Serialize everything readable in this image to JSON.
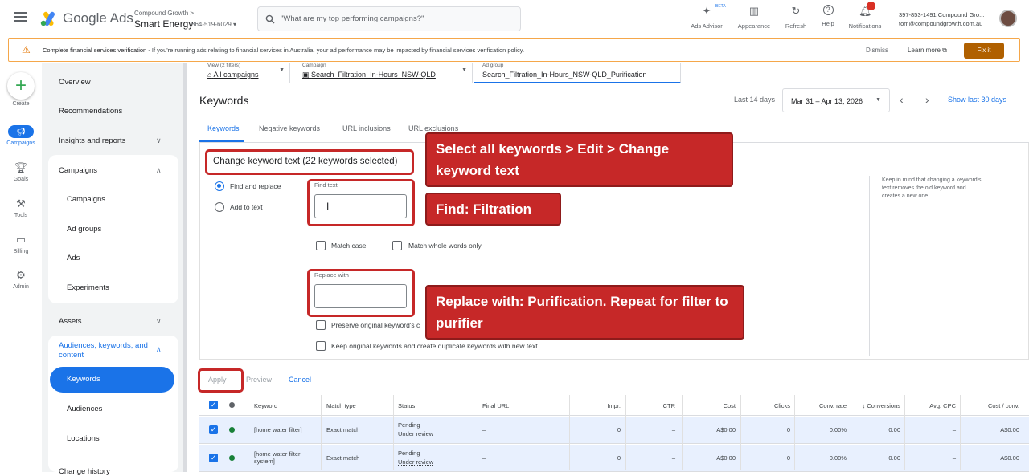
{
  "topbar": {
    "product": "Google Ads",
    "account_small": "Compound Growth",
    "account_name": "Smart Energy",
    "account_id": "864-519-6029",
    "search_placeholder": "\"What are my top performing campaigns?\"",
    "items": [
      {
        "label": "Ads Advisor",
        "icon": "sparkle-icon",
        "badge": "BETA"
      },
      {
        "label": "Appearance",
        "icon": "appearance-icon"
      },
      {
        "label": "Refresh",
        "icon": "refresh-icon"
      },
      {
        "label": "Help",
        "icon": "help-icon"
      },
      {
        "label": "Notifications",
        "icon": "bell-icon",
        "badge": "!"
      }
    ],
    "user_line1": "397-853-1491 Compound Gro...",
    "user_line2": "tom@compoundgrowth.com.au"
  },
  "banner": {
    "title": "Complete financial services verification",
    "message": " - If you're running ads relating to financial services in Australia, your ad performance may be impacted by financial services verification policy.",
    "dismiss": "Dismiss",
    "learn_more": "Learn more",
    "fix": "Fix it"
  },
  "rail": {
    "create": "Create",
    "campaigns": "Campaigns",
    "goals": "Goals",
    "tools": "Tools",
    "billing": "Billing",
    "admin": "Admin"
  },
  "nav": {
    "overview": "Overview",
    "recommendations": "Recommendations",
    "insights": "Insights and reports",
    "campaigns_group": "Campaigns",
    "campaigns": "Campaigns",
    "ad_groups": "Ad groups",
    "ads": "Ads",
    "experiments": "Experiments",
    "assets": "Assets",
    "audiences_group": "Audiences, keywords, and content",
    "keywords": "Keywords",
    "audiences": "Audiences",
    "locations": "Locations",
    "change_history": "Change history"
  },
  "filters": {
    "view_label": "View (2 filters)",
    "view_value": "All campaigns",
    "campaign_label": "Campaign",
    "campaign_value": "Search_Filtration_In-Hours_NSW-QLD",
    "adgroup_label": "Ad group",
    "adgroup_value": "Search_Filtration_In-Hours_NSW-QLD_Purification"
  },
  "page": {
    "title": "Keywords",
    "date_last": "Last 14 days",
    "date_range": "Mar 31 – Apr 13, 2026",
    "show_last": "Show last 30 days",
    "tabs": [
      "Keywords",
      "Negative keywords",
      "URL inclusions",
      "URL exclusions"
    ]
  },
  "panel": {
    "title": "Change keyword text (22 keywords selected)",
    "find_replace": "Find and replace",
    "add_to_text": "Add to text",
    "find_label": "Find text",
    "match_case": "Match case",
    "match_whole": "Match whole words only",
    "replace_label": "Replace with",
    "preserve": "Preserve original keyword's c",
    "keep_original": "Keep original keywords and create duplicate keywords with new text",
    "note": "Keep in mind that changing a keyword's text removes the old keyword and creates a new one.",
    "apply": "Apply",
    "preview": "Preview",
    "cancel": "Cancel"
  },
  "callouts": {
    "c1": "Select all keywords > Edit > Change keyword text",
    "c2": "Find: Filtration",
    "c3": "Replace with: Purification. Repeat for filter to purifier"
  },
  "table": {
    "headers": [
      "Keyword",
      "Match type",
      "Status",
      "Final URL",
      "Impr.",
      "CTR",
      "Cost",
      "Clicks",
      "Conv. rate",
      "Conversions",
      "Avg. CPC",
      "Cost / conv."
    ],
    "rows": [
      {
        "keyword": "[home water filter]",
        "match": "Exact match",
        "status1": "Pending",
        "status2": "Under review",
        "url": "–",
        "impr": "0",
        "ctr": "–",
        "cost": "A$0.00",
        "clicks": "0",
        "convrate": "0.00%",
        "conv": "0.00",
        "cpc": "–",
        "costconv": "A$0.00"
      },
      {
        "keyword": "[home water filter system]",
        "match": "Exact match",
        "status1": "Pending",
        "status2": "Under review",
        "url": "–",
        "impr": "0",
        "ctr": "–",
        "cost": "A$0.00",
        "clicks": "0",
        "convrate": "0.00%",
        "conv": "0.00",
        "cpc": "–",
        "costconv": "A$0.00"
      }
    ]
  }
}
